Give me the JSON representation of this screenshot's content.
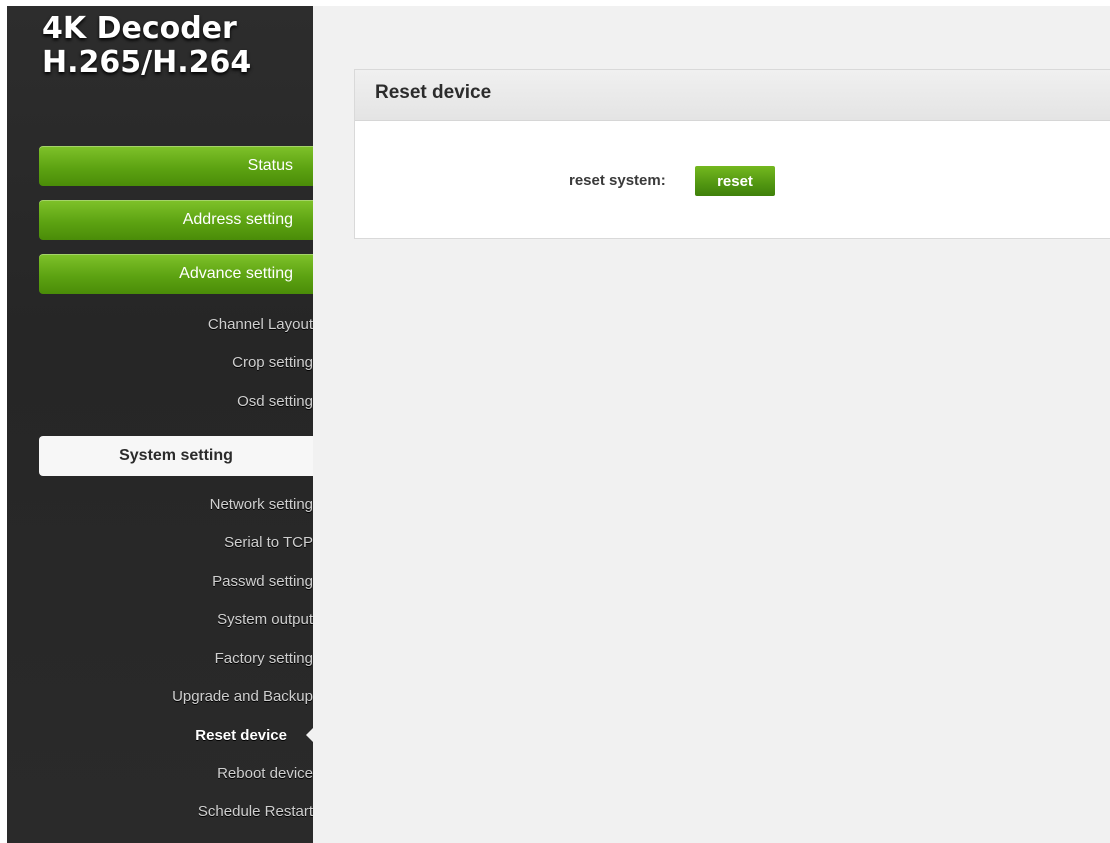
{
  "brand": {
    "line1": "4K Decoder",
    "line2": "H.265/H.264"
  },
  "nav": {
    "status": "Status",
    "address": "Address setting",
    "advance": "Advance setting",
    "advance_items": [
      "Channel Layout",
      "Crop setting",
      "Osd setting"
    ],
    "system": "System setting",
    "system_items": [
      "Network setting",
      "Serial to TCP",
      "Passwd setting",
      "System output",
      "Factory setting",
      "Upgrade and Backup",
      "Reset device",
      "Reboot device",
      "Schedule Restart"
    ],
    "active_item": "Reset device"
  },
  "panel": {
    "title": "Reset device",
    "label": "reset system:",
    "button": "reset"
  },
  "colors": {
    "accent": "#5da312",
    "sidebar": "#2a2a2a",
    "background": "#f1f1f1"
  }
}
